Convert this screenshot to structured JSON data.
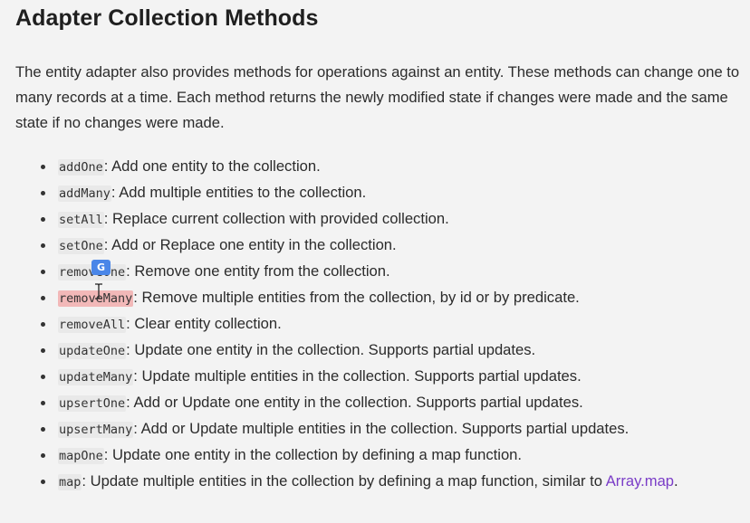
{
  "heading": "Adapter Collection Methods",
  "intro": "The entity adapter also provides methods for operations against an entity. These methods can change one to many records at a time. Each method returns the newly modified state if changes were made and the same state if no changes were made.",
  "methods": [
    {
      "name": "addOne",
      "description": ": Add one entity to the collection."
    },
    {
      "name": "addMany",
      "description": ": Add multiple entities to the collection."
    },
    {
      "name": "setAll",
      "description": ": Replace current collection with provided collection."
    },
    {
      "name": "setOne",
      "description": ": Add or Replace one entity in the collection."
    },
    {
      "name": "removeOne",
      "description": ": Remove one entity from the collection."
    },
    {
      "name": "removeMany",
      "description": ": Remove multiple entities from the collection, by id or by predicate."
    },
    {
      "name": "removeAll",
      "description": ": Clear entity collection."
    },
    {
      "name": "updateOne",
      "description": ": Update one entity in the collection. Supports partial updates."
    },
    {
      "name": "updateMany",
      "description": ": Update multiple entities in the collection. Supports partial updates."
    },
    {
      "name": "upsertOne",
      "description": ": Add or Update one entity in the collection. Supports partial updates."
    },
    {
      "name": "upsertMany",
      "description": ": Add or Update multiple entities in the collection. Supports partial updates."
    },
    {
      "name": "mapOne",
      "description": ": Update one entity in the collection by defining a map function."
    },
    {
      "name": "map",
      "description": ": Update multiple entities in the collection by defining a map function, similar to "
    }
  ],
  "map_link": "Array.map",
  "map_trailing": ".",
  "overlay": {
    "cursor_badge_label": "G"
  },
  "colors": {
    "link": "#7a3cc7",
    "highlight": "#f2b8b8",
    "badge": "#4a86e8"
  }
}
